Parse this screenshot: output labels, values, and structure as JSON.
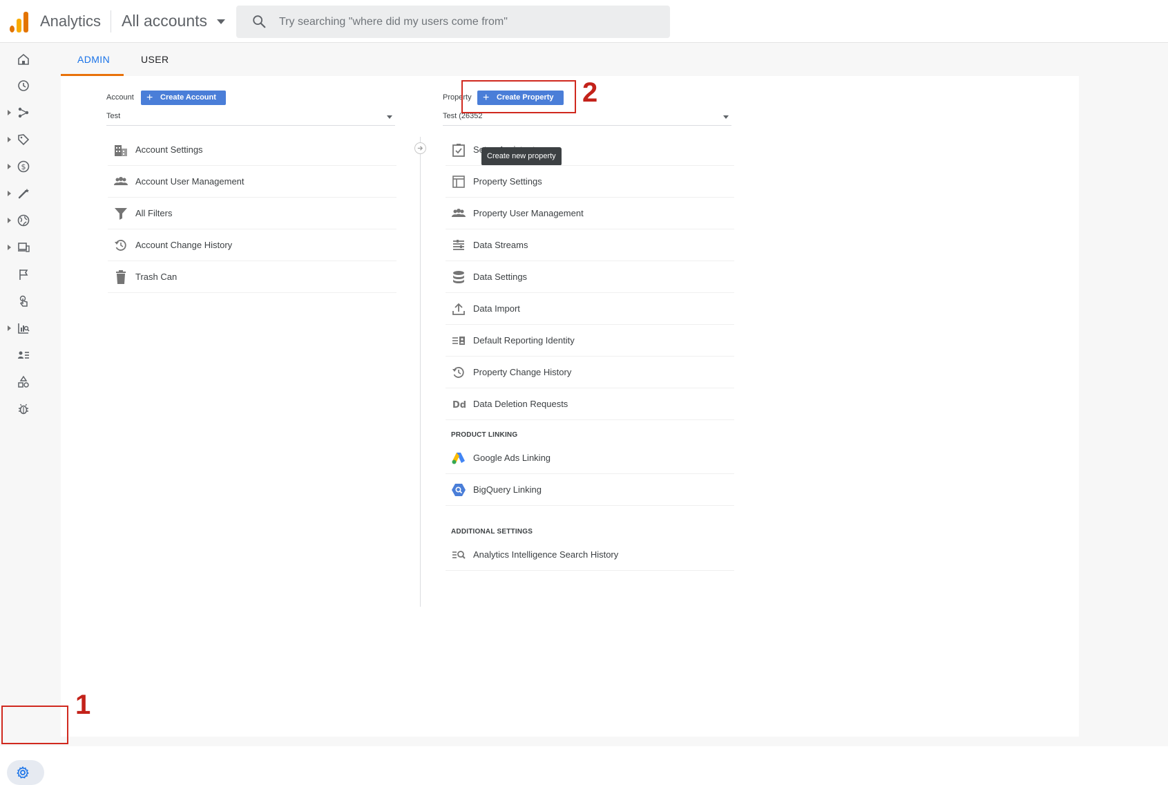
{
  "header": {
    "app_name": "Analytics",
    "account_picker": "All accounts",
    "search_placeholder": "Try searching \"where did my users come from\"",
    "logo_colors": [
      "#f9ab00",
      "#e37400",
      "#e37400"
    ]
  },
  "left_nav": {
    "items": [
      "home-icon",
      "clock-icon",
      "share-icon",
      "tag-icon",
      "dollar-icon",
      "magic-wand-icon",
      "globe-icon",
      "devices-icon",
      "flag-icon",
      "touch-icon",
      "report-search-icon",
      "user-list-icon",
      "shapes-icon",
      "bug-icon"
    ],
    "admin_icon": "gear-icon"
  },
  "tabs": {
    "admin": "ADMIN",
    "user": "USER",
    "active": "ADMIN"
  },
  "account_column": {
    "label": "Account",
    "create_button": "Create Account",
    "selected": "Test",
    "items": [
      {
        "label": "Account Settings",
        "icon": "building-icon"
      },
      {
        "label": "Account User Management",
        "icon": "people-icon"
      },
      {
        "label": "All Filters",
        "icon": "filter-icon"
      },
      {
        "label": "Account Change History",
        "icon": "history-icon"
      },
      {
        "label": "Trash Can",
        "icon": "trash-icon"
      }
    ]
  },
  "property_column": {
    "label": "Property",
    "create_button": "Create Property",
    "selected": "Test (26352",
    "tooltip": "Create new property",
    "items": [
      {
        "label": "Setup Assistant",
        "icon": "checkbox-icon"
      },
      {
        "label": "Property Settings",
        "icon": "layout-icon"
      },
      {
        "label": "Property User Management",
        "icon": "people-icon"
      },
      {
        "label": "Data Streams",
        "icon": "streams-icon"
      },
      {
        "label": "Data Settings",
        "icon": "database-icon"
      },
      {
        "label": "Data Import",
        "icon": "upload-icon"
      },
      {
        "label": "Default Reporting Identity",
        "icon": "identity-icon"
      },
      {
        "label": "Property Change History",
        "icon": "history-icon"
      },
      {
        "label": "Data Deletion Requests",
        "icon": "dd-icon"
      }
    ],
    "product_linking": {
      "title": "PRODUCT LINKING",
      "items": [
        {
          "label": "Google Ads Linking",
          "icon": "google-ads-icon"
        },
        {
          "label": "BigQuery Linking",
          "icon": "bigquery-icon"
        }
      ]
    },
    "additional_settings": {
      "title": "ADDITIONAL SETTINGS",
      "items": [
        {
          "label": "Analytics Intelligence Search History",
          "icon": "search-history-icon"
        }
      ]
    }
  },
  "annotations": {
    "step1": "1",
    "step2": "2",
    "color": "#d0281e"
  },
  "colors": {
    "accent_blue": "#1a73e8",
    "button_blue": "#4a7ed8",
    "tab_underline": "#e8710a"
  }
}
